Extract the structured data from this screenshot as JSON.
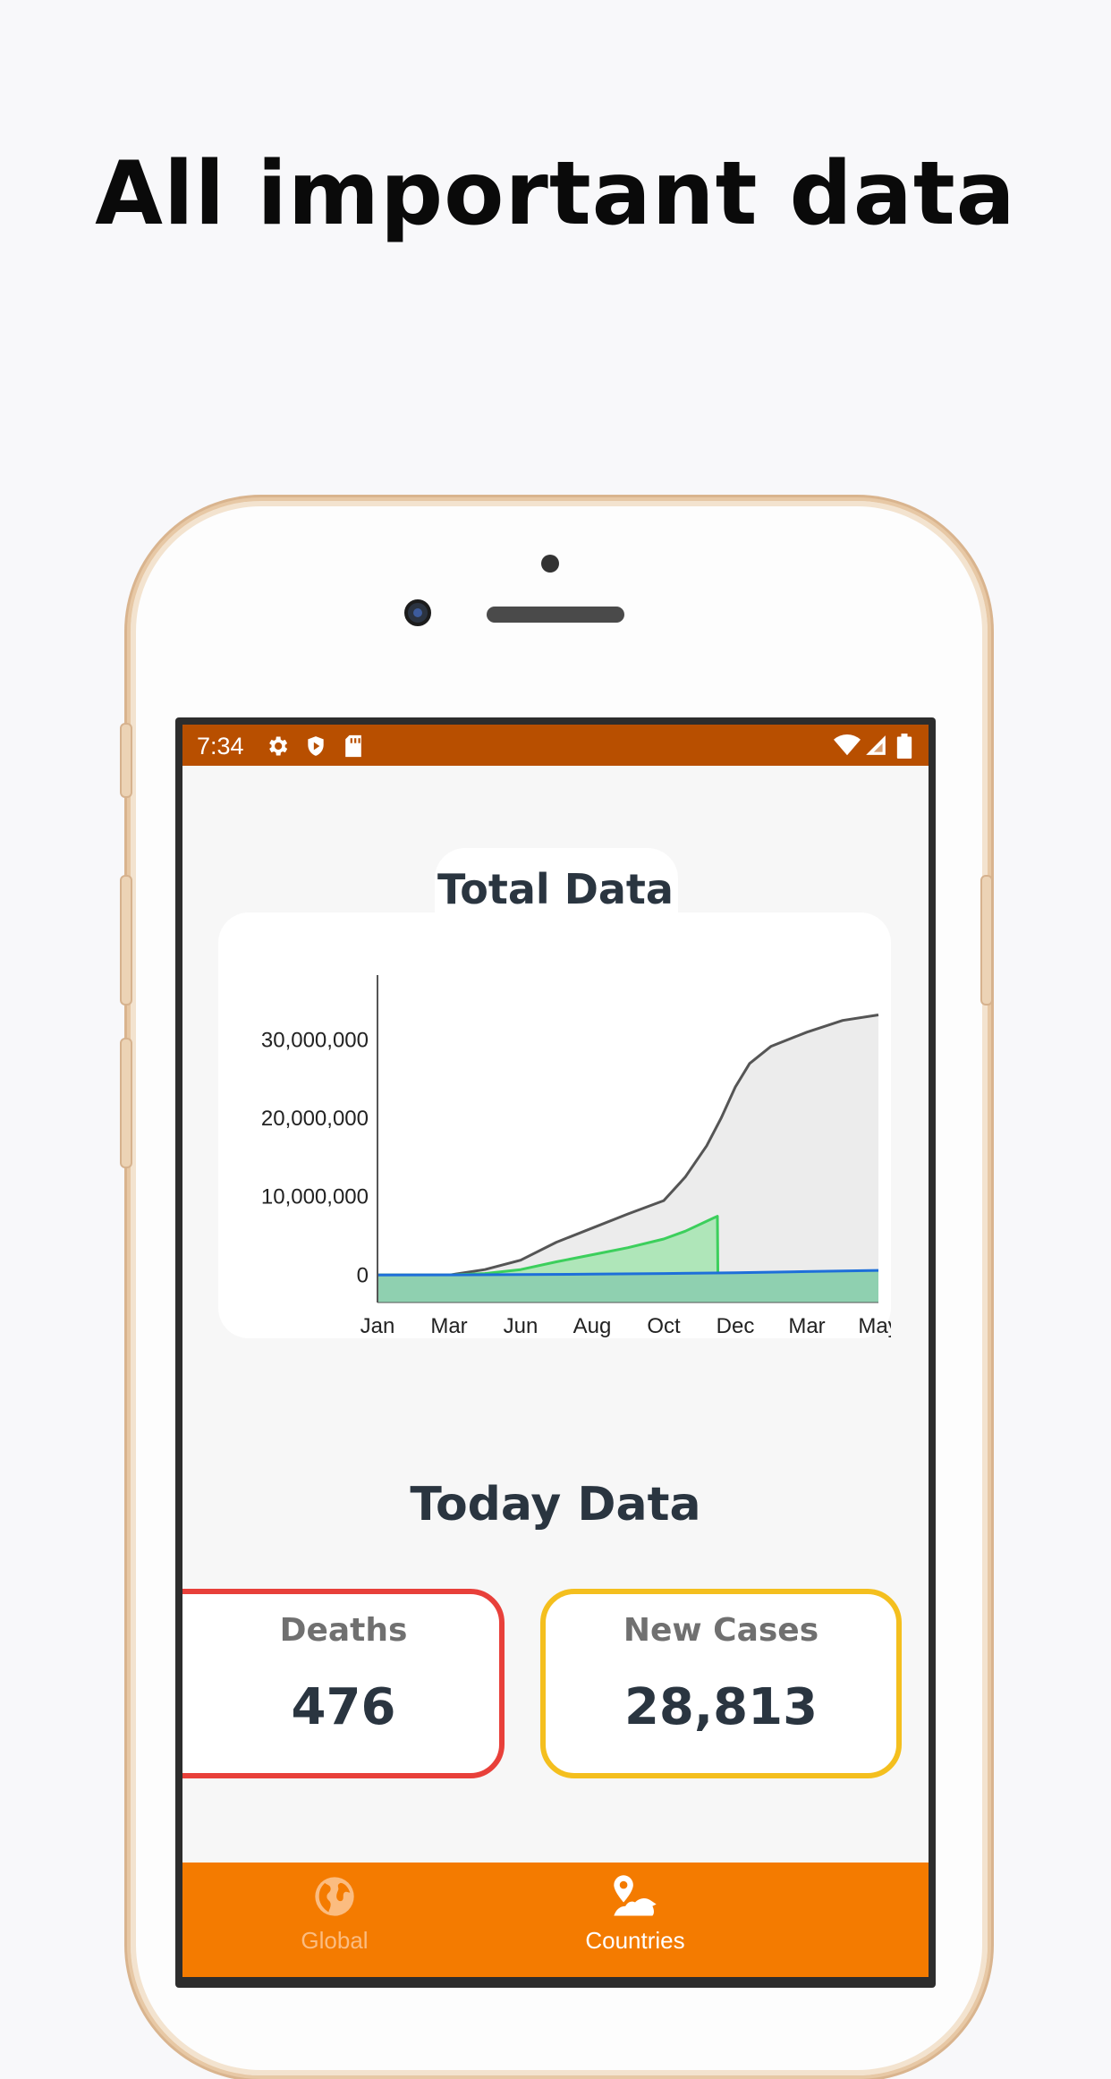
{
  "headline": "All important data",
  "status_bar": {
    "time": "7:34",
    "left_icons": [
      "gear-icon",
      "shield-icon",
      "sd-card-icon"
    ],
    "right_icons": [
      "wifi-icon",
      "signal-icon",
      "battery-icon"
    ],
    "color": "#b84f00"
  },
  "total_data": {
    "title": "Total Data"
  },
  "chart_data": {
    "type": "area",
    "x_ticks": [
      "Jan",
      "Mar",
      "Jun",
      "Aug",
      "Oct",
      "Dec",
      "Mar",
      "May"
    ],
    "y_ticks": [
      "0",
      "10,000,000",
      "20,000,000",
      "30,000,000"
    ],
    "ylim": [
      -3500000,
      36000000
    ],
    "grid": false,
    "legend": "none",
    "series": [
      {
        "color": "#555555",
        "fill": "#ececec",
        "x": [
          0,
          1,
          1.5,
          2,
          2.5,
          3,
          3.5,
          4,
          4.3,
          4.6,
          4.8,
          5.0,
          5.2,
          5.5,
          6.0,
          6.5,
          7.0
        ],
        "values": [
          0,
          0,
          700000,
          1900000,
          4200000,
          6000000,
          7800000,
          9500000,
          12500000,
          16500000,
          20000000,
          24000000,
          27000000,
          29200000,
          31000000,
          32500000,
          33200000
        ]
      },
      {
        "color": "#3ccf5c",
        "fill": "#a8e6b4",
        "x": [
          0,
          1,
          1.5,
          2,
          2.5,
          3,
          3.5,
          4,
          4.3,
          4.7,
          4.75,
          4.76
        ],
        "values": [
          0,
          0,
          200000,
          700000,
          1700000,
          2600000,
          3500000,
          4600000,
          5600000,
          7300000,
          7500000,
          -3500000
        ]
      },
      {
        "color": "#1e6fd9",
        "fill": "#8fd0b0",
        "x": [
          0,
          1,
          2,
          3,
          4,
          5,
          6,
          7
        ],
        "values": [
          0,
          30000,
          60000,
          120000,
          200000,
          300000,
          450000,
          600000
        ]
      }
    ]
  },
  "today_data": {
    "title": "Today Data",
    "deaths": {
      "label": "Deaths",
      "value": "476",
      "color": "#e8403a"
    },
    "new_cases": {
      "label": "New Cases",
      "value": "28,813",
      "color": "#f4bf1e"
    }
  },
  "bottom_nav": {
    "items": [
      {
        "label": "Global",
        "icon": "globe-icon",
        "active": false
      },
      {
        "label": "Countries",
        "icon": "map-pin-icon",
        "active": true
      }
    ],
    "color": "#f47b00"
  }
}
